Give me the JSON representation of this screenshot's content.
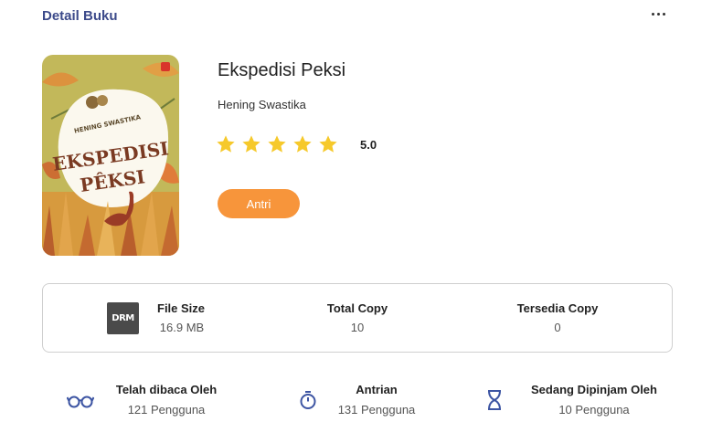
{
  "header": {
    "title": "Detail Buku",
    "more_icon": "more-horizontal-icon"
  },
  "book": {
    "cover_text": {
      "author": "HENING SWASTIKA",
      "title_line1": "EKSPEDISI",
      "title_line2": "PÊKSI"
    },
    "title": "Ekspedisi Peksi",
    "author": "Hening Swastika",
    "rating": 5.0,
    "rating_label": "5.0",
    "star_color": "#f6c92b"
  },
  "actions": {
    "queue_label": "Antri",
    "queue_color": "#f7953b"
  },
  "info": {
    "drm_label": "DRM",
    "file_size": {
      "label": "File Size",
      "value": "16.9 MB"
    },
    "total_copy": {
      "label": "Total Copy",
      "value": "10"
    },
    "available_copy": {
      "label": "Tersedia Copy",
      "value": "0"
    }
  },
  "stats": {
    "read_by": {
      "label": "Telah dibaca Oleh",
      "value": "121 Pengguna",
      "icon": "glasses-icon"
    },
    "queue": {
      "label": "Antrian",
      "value": "131 Pengguna",
      "icon": "stopwatch-icon"
    },
    "borrowing": {
      "label": "Sedang Dipinjam Oleh",
      "value": "10 Pengguna",
      "icon": "hourglass-icon"
    }
  },
  "colors": {
    "accent": "#3c4a8a",
    "icon_blue": "#3d55a3"
  }
}
